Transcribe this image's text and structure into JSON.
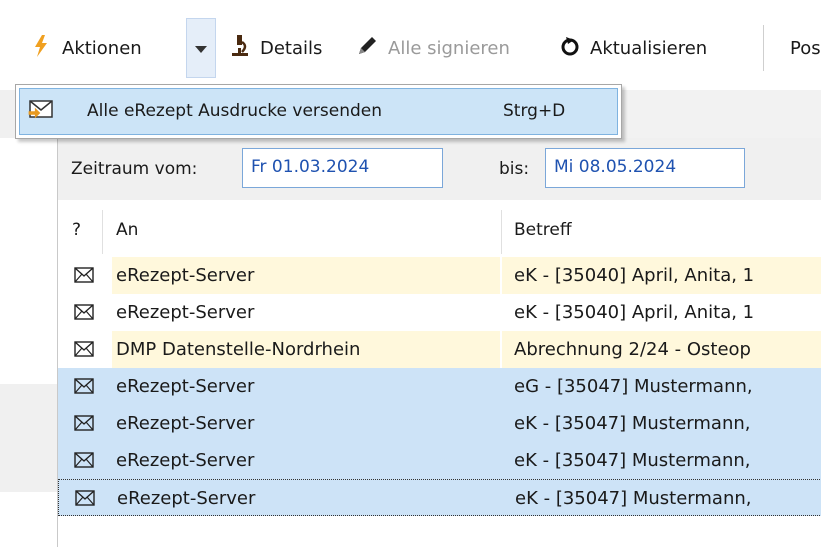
{
  "toolbar": {
    "aktionen_label": "Aktionen",
    "details_label": "Details",
    "alle_signieren_label": "Alle signieren",
    "aktualisieren_label": "Aktualisieren",
    "truncated_label": "Pos"
  },
  "menu": {
    "item_label": "Alle eRezept Ausdrucke versenden",
    "item_shortcut": "Strg+D"
  },
  "filter": {
    "from_label": "Zeitraum vom:",
    "from_value": "Fr 01.03.2024",
    "to_label": "bis:",
    "to_value": "Mi 08.05.2024"
  },
  "grid": {
    "columns": {
      "flag": "?",
      "an": "An",
      "betreff": "Betreff"
    },
    "rows": [
      {
        "an": "eRezept-Server",
        "betreff": "eK - [35040] April, Anita, 1",
        "state": "highlight"
      },
      {
        "an": "eRezept-Server",
        "betreff": "eK - [35040] April, Anita, 1",
        "state": "normal"
      },
      {
        "an": "DMP Datenstelle-Nordrhein",
        "betreff": "Abrechnung 2/24 - Osteop",
        "state": "highlight"
      },
      {
        "an": "eRezept-Server",
        "betreff": "eG - [35047] Mustermann,",
        "state": "selected"
      },
      {
        "an": "eRezept-Server",
        "betreff": "eK - [35047] Mustermann,",
        "state": "selected"
      },
      {
        "an": "eRezept-Server",
        "betreff": "eK - [35047] Mustermann,",
        "state": "selected"
      },
      {
        "an": "eRezept-Server",
        "betreff": "eK - [35047] Mustermann,",
        "state": "selected-focused"
      }
    ]
  },
  "colors": {
    "highlight_row": "#fff8dc",
    "selected_row": "#cde3f7",
    "menu_hover": "#cce4f7",
    "date_text": "#1f52b0"
  },
  "icons": {
    "aktionen": "lightning-icon",
    "dropdown": "chevron-down-icon",
    "details": "microscope-icon",
    "signieren": "pen-icon",
    "aktualisieren": "refresh-icon",
    "menu_item": "envelope-arrow-icon",
    "row": "envelope-icon"
  }
}
